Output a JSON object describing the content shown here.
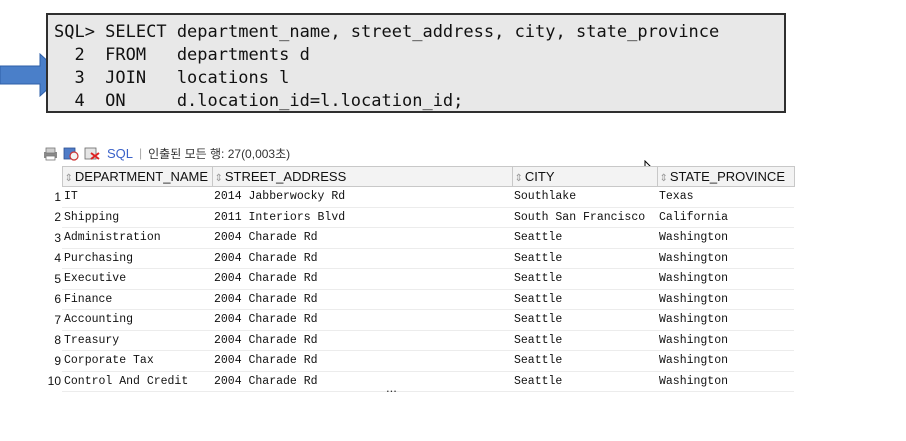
{
  "sql": {
    "lines": [
      "SQL> SELECT department_name, street_address, city, state_province",
      "  2  FROM   departments d",
      "  3  JOIN   locations l",
      "  4  ON     d.location_id=l.location_id;"
    ],
    "arrow_color": "#4a7fc9"
  },
  "toolbar": {
    "icons": [
      "pin-icon",
      "refresh-icon",
      "export-icon"
    ],
    "sql_label": "SQL",
    "status": "인출된 모든 행: 27(0,003초)"
  },
  "grid": {
    "columns": [
      "DEPARTMENT_NAME",
      "STREET_ADDRESS",
      "CITY",
      "STATE_PROVINCE"
    ],
    "rows": [
      {
        "n": "1",
        "dept": "IT",
        "street": "2014 Jabberwocky Rd",
        "city": "Southlake",
        "state": "Texas"
      },
      {
        "n": "2",
        "dept": "Shipping",
        "street": "2011 Interiors Blvd",
        "city": "South San Francisco",
        "state": "California"
      },
      {
        "n": "3",
        "dept": "Administration",
        "street": "2004 Charade Rd",
        "city": "Seattle",
        "state": "Washington"
      },
      {
        "n": "4",
        "dept": "Purchasing",
        "street": "2004 Charade Rd",
        "city": "Seattle",
        "state": "Washington"
      },
      {
        "n": "5",
        "dept": "Executive",
        "street": "2004 Charade Rd",
        "city": "Seattle",
        "state": "Washington"
      },
      {
        "n": "6",
        "dept": "Finance",
        "street": "2004 Charade Rd",
        "city": "Seattle",
        "state": "Washington"
      },
      {
        "n": "7",
        "dept": "Accounting",
        "street": "2004 Charade Rd",
        "city": "Seattle",
        "state": "Washington"
      },
      {
        "n": "8",
        "dept": "Treasury",
        "street": "2004 Charade Rd",
        "city": "Seattle",
        "state": "Washington"
      },
      {
        "n": "9",
        "dept": "Corporate Tax",
        "street": "2004 Charade Rd",
        "city": "Seattle",
        "state": "Washington"
      },
      {
        "n": "10",
        "dept": "Control And Credit",
        "street": "2004 Charade Rd",
        "city": "Seattle",
        "state": "Washington"
      }
    ],
    "more_indicator": "..."
  }
}
